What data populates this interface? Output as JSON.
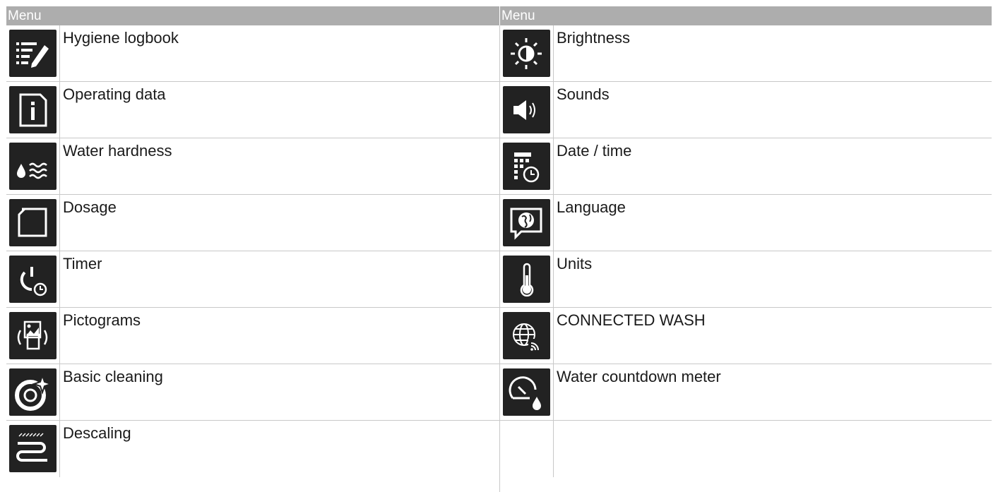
{
  "left": {
    "header": "Menu",
    "items": [
      {
        "label": "Hygiene logbook",
        "icon": "hygiene-logbook-icon"
      },
      {
        "label": "Operating data",
        "icon": "info-icon"
      },
      {
        "label": "Water hardness",
        "icon": "water-hardness-icon"
      },
      {
        "label": "Dosage",
        "icon": "dosage-icon"
      },
      {
        "label": "Timer",
        "icon": "timer-icon"
      },
      {
        "label": "Pictograms",
        "icon": "pictograms-icon"
      },
      {
        "label": "Basic cleaning",
        "icon": "basic-cleaning-icon"
      },
      {
        "label": "Descaling",
        "icon": "descaling-icon"
      }
    ]
  },
  "right": {
    "header": "Menu",
    "items": [
      {
        "label": "Brightness",
        "icon": "brightness-icon"
      },
      {
        "label": "Sounds",
        "icon": "speaker-icon"
      },
      {
        "label": "Date / time",
        "icon": "calendar-clock-icon"
      },
      {
        "label": "Language",
        "icon": "globe-speech-icon"
      },
      {
        "label": "Units",
        "icon": "thermometer-icon"
      },
      {
        "label": "CONNECTED WASH",
        "icon": "globe-wifi-icon"
      },
      {
        "label": "Water countdown meter",
        "icon": "water-meter-icon"
      }
    ]
  },
  "colors": {
    "header_bg": "#adadad",
    "icon_bg": "#222222",
    "border": "#c8c8c8"
  }
}
